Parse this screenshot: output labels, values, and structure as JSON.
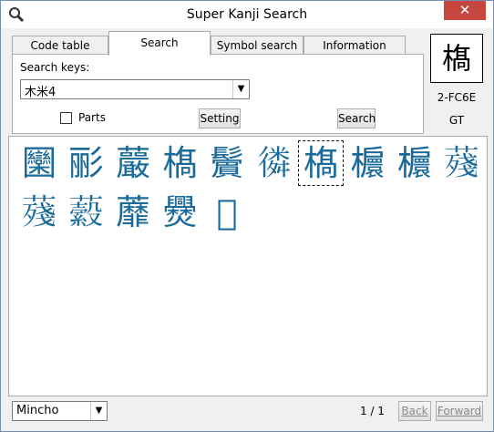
{
  "window": {
    "title": "Super Kanji Search",
    "close": "✕"
  },
  "tabs": [
    {
      "label": "Code table",
      "active": false
    },
    {
      "label": "Search",
      "active": true
    },
    {
      "label": "Symbol search",
      "active": false
    },
    {
      "label": "Information",
      "active": false
    }
  ],
  "search": {
    "keys_label": "Search keys:",
    "keys_value": "木⽶4",
    "parts_label": "Parts",
    "parts_checked": false,
    "setting_label": "Setting",
    "search_label": "Search"
  },
  "preview": {
    "glyph": "𣘺",
    "code": "2-FC6E",
    "font_tag": "GT"
  },
  "results": {
    "glyphs": [
      "圞",
      "彨",
      "䕾",
      "𣘺",
      "𩯭",
      "𢕸",
      "𣘺",
      "𣟴",
      "𣟴",
      "𦺐",
      "𦺐",
      "𧂔",
      "蘼",
      "㸑",
      "𤗼"
    ],
    "selected_index": 6
  },
  "footer": {
    "font_value": "Mincho",
    "page_text": "1 / 1",
    "back_label": "Back",
    "forward_label": "Forward"
  },
  "colors": {
    "glyph": "#1a6a9a",
    "close": "#c7463d"
  }
}
